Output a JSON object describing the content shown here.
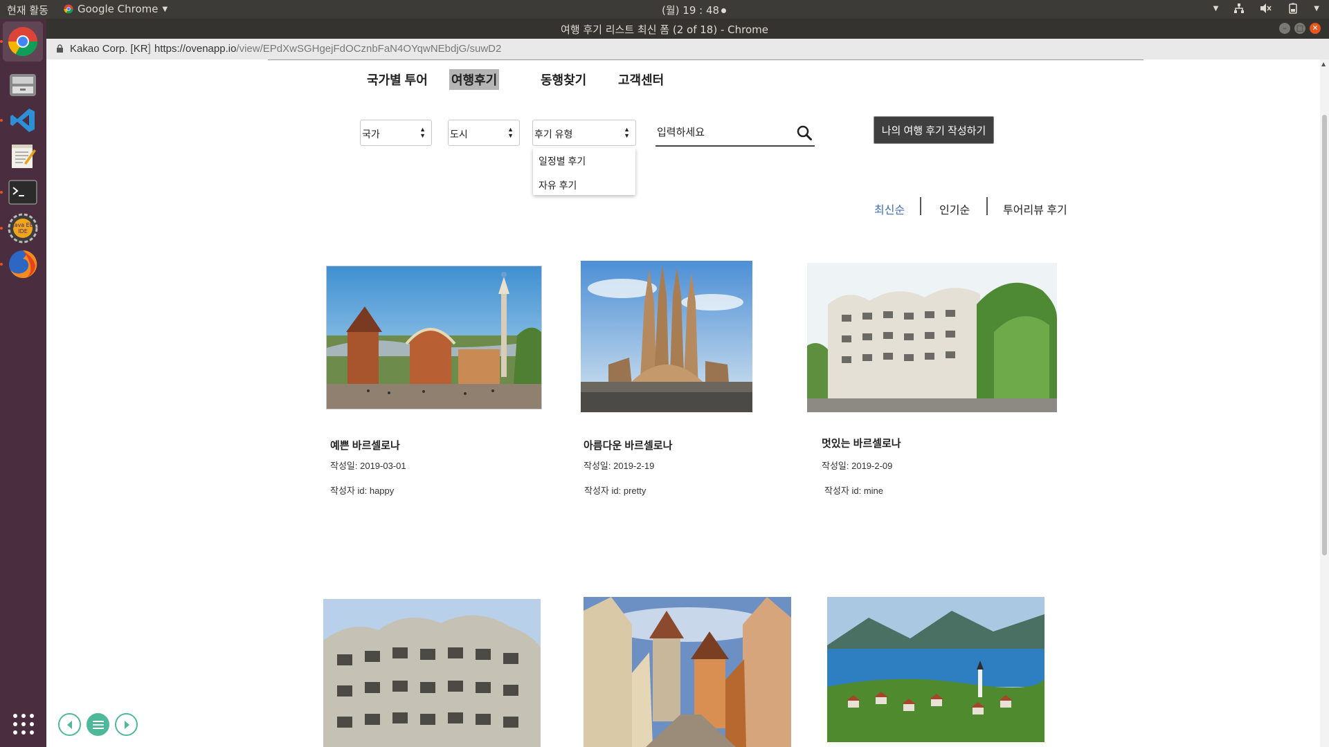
{
  "top_panel": {
    "activities": "현재 활동",
    "app_name": "Google Chrome",
    "clock": "(월) 19 : 48"
  },
  "window": {
    "title": "여행 후기 리스트 최신 폼 (2 of 18) - Chrome"
  },
  "address_bar": {
    "owner": "Kakao Corp. [KR]",
    "url_host": "https://ovenapp.io",
    "url_path": "/view/EPdXwSGHgejFdOCznbFaN4OYqwNEbdjG/suwD2"
  },
  "nav": {
    "items": [
      "국가별 투어",
      "여행후기",
      "동행찾기",
      "고객센터"
    ],
    "selected": "여행후기"
  },
  "filters": {
    "country": "국가",
    "city": "도시",
    "review_type": "후기 유형",
    "review_type_options": [
      "일정별 후기",
      "자유 후기"
    ],
    "search_placeholder": "입력하세요",
    "write_button": "나의 여행 후기 작성하기"
  },
  "sort": {
    "items": [
      "최신순",
      "인기순",
      "투어리뷰 후기"
    ],
    "active": "최신순",
    "active_color": "#3f6eb3"
  },
  "cards": [
    {
      "title": "예쁜 바르셀로나",
      "date": "작성일: 2019-03-01",
      "author": "작성자 id: happy",
      "image": "park-guell-photo"
    },
    {
      "title": "아름다운 바르셀로나",
      "date": "작성일: 2019-2-19",
      "author": "작성자 id: pretty",
      "image": "sagrada-familia-photo"
    },
    {
      "title": "멋있는 바르셀로나",
      "date": "작성일: 2019-2-09",
      "author": "작성자 id: mine",
      "image": "casa-mila-photo"
    },
    {
      "image": "casa-mila-closeup-photo"
    },
    {
      "image": "rothenburg-street-photo"
    },
    {
      "image": "lake-village-photo"
    }
  ],
  "colors": {
    "panel": "#3c3b37",
    "launcher": "#4a2d3e",
    "accent_green": "#4fb89a",
    "button_dark": "#3f3f3f"
  }
}
